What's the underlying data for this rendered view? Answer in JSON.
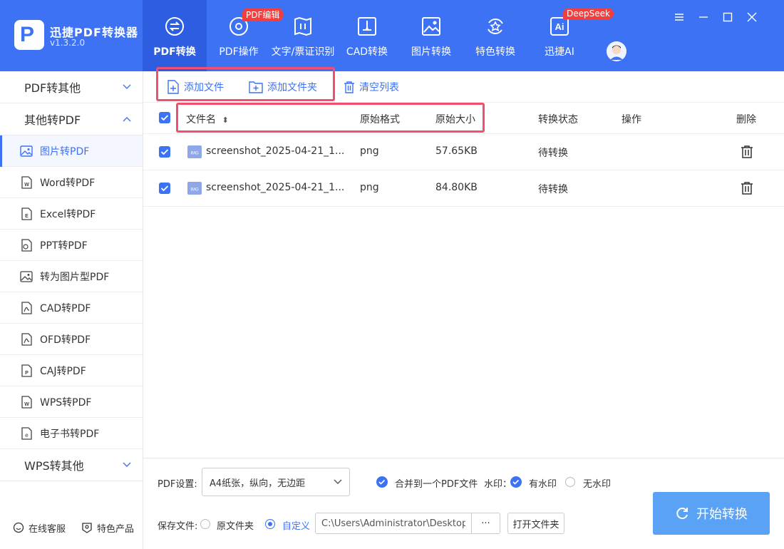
{
  "app": {
    "name": "迅捷PDF转换器",
    "version": "v1.3.2.0",
    "logo_letter": "P"
  },
  "nav": [
    {
      "label": "PDF转换",
      "icon": "convert-icon",
      "active": true
    },
    {
      "label": "PDF操作",
      "icon": "gear-circle-icon",
      "badge": "PDF编辑"
    },
    {
      "label": "文字/票证识别",
      "icon": "scan-icon"
    },
    {
      "label": "CAD转换",
      "icon": "cad-icon"
    },
    {
      "label": "图片转换",
      "icon": "image-icon"
    },
    {
      "label": "特色转换",
      "icon": "star-refresh-icon"
    },
    {
      "label": "迅捷AI",
      "icon": "ai-icon",
      "badge": "DeepSeek"
    }
  ],
  "sidebar": {
    "groups": [
      {
        "label": "PDF转其他"
      },
      {
        "label": "其他转PDF"
      },
      {
        "label": "WPS转其他"
      }
    ],
    "items": [
      {
        "label": "图片转PDF",
        "active": true
      },
      {
        "label": "Word转PDF"
      },
      {
        "label": "Excel转PDF"
      },
      {
        "label": "PPT转PDF"
      },
      {
        "label": "转为图片型PDF"
      },
      {
        "label": "CAD转PDF"
      },
      {
        "label": "OFD转PDF"
      },
      {
        "label": "CAJ转PDF"
      },
      {
        "label": "WPS转PDF"
      },
      {
        "label": "电子书转PDF"
      }
    ],
    "footer": {
      "service": "在线客服",
      "products": "特色产品"
    }
  },
  "toolbar": {
    "add_file": "添加文件",
    "add_folder": "添加文件夹",
    "clear_list": "清空列表"
  },
  "table": {
    "headers": {
      "name": "文件名",
      "sort_mark": "⬍",
      "format": "原始格式",
      "size": "原始大小",
      "status": "转换状态",
      "action": "操作",
      "delete": "删除"
    },
    "rows": [
      {
        "name": "screenshot_2025-04-21_1...",
        "format": "png",
        "size": "57.65KB",
        "status": "待转换"
      },
      {
        "name": "screenshot_2025-04-21_1...",
        "format": "png",
        "size": "84.80KB",
        "status": "待转换"
      }
    ],
    "file_icon_text": "IMG"
  },
  "bottom": {
    "pdf_settings_label": "PDF设置:",
    "pdf_settings_value": "A4纸张，纵向，无边距",
    "merge_label": "合并到一个PDF文件",
    "watermark_label": "水印：",
    "watermark_yes": "有水印",
    "watermark_no": "无水印",
    "save_label": "保存文件:",
    "save_original": "原文件夹",
    "save_custom": "自定义",
    "save_path": "C:\\Users\\Administrator\\Desktop",
    "dots": "···",
    "open_folder": "打开文件夹",
    "start": "开始转换"
  },
  "colors": {
    "primary": "#3d72f5",
    "header": "#3d72f5",
    "badge": "#f43d3d",
    "highlight": "#f0506e",
    "start_button": "#5aa2f5"
  }
}
